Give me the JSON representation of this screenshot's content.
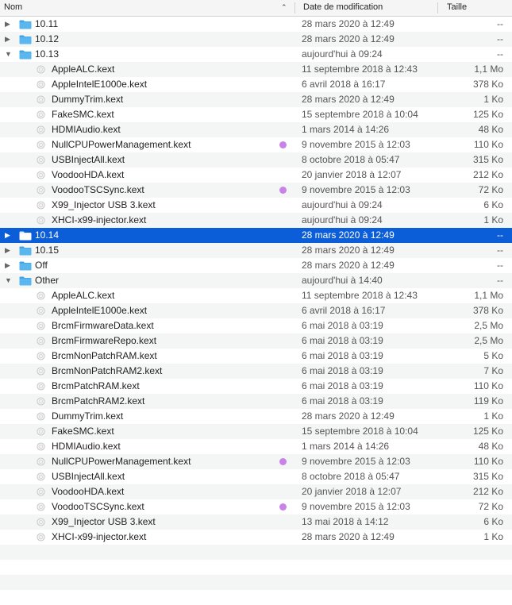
{
  "header": {
    "name_label": "Nom",
    "date_label": "Date de modification",
    "size_label": "Taille"
  },
  "colors": {
    "selection": "#0b5ed7",
    "folder": "#5ab6ee",
    "tag_purple": "#c983e8"
  },
  "rows": [
    {
      "type": "folder",
      "depth": 0,
      "expanded": false,
      "name": "10.11",
      "date": "28 mars 2020 à 12:49",
      "size": "--"
    },
    {
      "type": "folder",
      "depth": 0,
      "expanded": false,
      "name": "10.12",
      "date": "28 mars 2020 à 12:49",
      "size": "--"
    },
    {
      "type": "folder",
      "depth": 0,
      "expanded": true,
      "name": "10.13",
      "date": "aujourd'hui à 09:24",
      "size": "--"
    },
    {
      "type": "file",
      "depth": 1,
      "name": "AppleALC.kext",
      "date": "11 septembre 2018 à 12:43",
      "size": "1,1 Mo"
    },
    {
      "type": "file",
      "depth": 1,
      "name": "AppleIntelE1000e.kext",
      "date": "6 avril 2018 à 16:17",
      "size": "378 Ko"
    },
    {
      "type": "file",
      "depth": 1,
      "name": "DummyTrim.kext",
      "date": "28 mars 2020 à 12:49",
      "size": "1 Ko"
    },
    {
      "type": "file",
      "depth": 1,
      "name": "FakeSMC.kext",
      "date": "15 septembre 2018 à 10:04",
      "size": "125 Ko"
    },
    {
      "type": "file",
      "depth": 1,
      "name": "HDMIAudio.kext",
      "date": "1 mars 2014 à 14:26",
      "size": "48 Ko"
    },
    {
      "type": "file",
      "depth": 1,
      "name": "NullCPUPowerManagement.kext",
      "date": "9 novembre 2015 à 12:03",
      "size": "110 Ko",
      "tag": "purple"
    },
    {
      "type": "file",
      "depth": 1,
      "name": "USBInjectAll.kext",
      "date": "8 octobre 2018 à 05:47",
      "size": "315 Ko"
    },
    {
      "type": "file",
      "depth": 1,
      "name": "VoodooHDA.kext",
      "date": "20 janvier 2018 à 12:07",
      "size": "212 Ko"
    },
    {
      "type": "file",
      "depth": 1,
      "name": "VoodooTSCSync.kext",
      "date": "9 novembre 2015 à 12:03",
      "size": "72 Ko",
      "tag": "purple"
    },
    {
      "type": "file",
      "depth": 1,
      "name": "X99_Injector USB 3.kext",
      "date": "aujourd'hui à 09:24",
      "size": "6 Ko"
    },
    {
      "type": "file",
      "depth": 1,
      "name": "XHCI-x99-injector.kext",
      "date": "aujourd'hui à 09:24",
      "size": "1 Ko"
    },
    {
      "type": "folder",
      "depth": 0,
      "expanded": false,
      "selected": true,
      "name": "10.14",
      "date": "28 mars 2020 à 12:49",
      "size": "--"
    },
    {
      "type": "folder",
      "depth": 0,
      "expanded": false,
      "name": "10.15",
      "date": "28 mars 2020 à 12:49",
      "size": "--"
    },
    {
      "type": "folder",
      "depth": 0,
      "expanded": false,
      "name": "Off",
      "date": "28 mars 2020 à 12:49",
      "size": "--"
    },
    {
      "type": "folder",
      "depth": 0,
      "expanded": true,
      "name": "Other",
      "date": "aujourd'hui à 14:40",
      "size": "--"
    },
    {
      "type": "file",
      "depth": 1,
      "name": "AppleALC.kext",
      "date": "11 septembre 2018 à 12:43",
      "size": "1,1 Mo"
    },
    {
      "type": "file",
      "depth": 1,
      "name": "AppleIntelE1000e.kext",
      "date": "6 avril 2018 à 16:17",
      "size": "378 Ko"
    },
    {
      "type": "file",
      "depth": 1,
      "name": "BrcmFirmwareData.kext",
      "date": "6 mai 2018 à 03:19",
      "size": "2,5 Mo"
    },
    {
      "type": "file",
      "depth": 1,
      "name": "BrcmFirmwareRepo.kext",
      "date": "6 mai 2018 à 03:19",
      "size": "2,5 Mo"
    },
    {
      "type": "file",
      "depth": 1,
      "name": "BrcmNonPatchRAM.kext",
      "date": "6 mai 2018 à 03:19",
      "size": "5 Ko"
    },
    {
      "type": "file",
      "depth": 1,
      "name": "BrcmNonPatchRAM2.kext",
      "date": "6 mai 2018 à 03:19",
      "size": "7 Ko"
    },
    {
      "type": "file",
      "depth": 1,
      "name": "BrcmPatchRAM.kext",
      "date": "6 mai 2018 à 03:19",
      "size": "110 Ko"
    },
    {
      "type": "file",
      "depth": 1,
      "name": "BrcmPatchRAM2.kext",
      "date": "6 mai 2018 à 03:19",
      "size": "119 Ko"
    },
    {
      "type": "file",
      "depth": 1,
      "name": "DummyTrim.kext",
      "date": "28 mars 2020 à 12:49",
      "size": "1 Ko"
    },
    {
      "type": "file",
      "depth": 1,
      "name": "FakeSMC.kext",
      "date": "15 septembre 2018 à 10:04",
      "size": "125 Ko"
    },
    {
      "type": "file",
      "depth": 1,
      "name": "HDMIAudio.kext",
      "date": "1 mars 2014 à 14:26",
      "size": "48 Ko"
    },
    {
      "type": "file",
      "depth": 1,
      "name": "NullCPUPowerManagement.kext",
      "date": "9 novembre 2015 à 12:03",
      "size": "110 Ko",
      "tag": "purple"
    },
    {
      "type": "file",
      "depth": 1,
      "name": "USBInjectAll.kext",
      "date": "8 octobre 2018 à 05:47",
      "size": "315 Ko"
    },
    {
      "type": "file",
      "depth": 1,
      "name": "VoodooHDA.kext",
      "date": "20 janvier 2018 à 12:07",
      "size": "212 Ko"
    },
    {
      "type": "file",
      "depth": 1,
      "name": "VoodooTSCSync.kext",
      "date": "9 novembre 2015 à 12:03",
      "size": "72 Ko",
      "tag": "purple"
    },
    {
      "type": "file",
      "depth": 1,
      "name": "X99_Injector USB 3.kext",
      "date": "13 mai 2018 à 14:12",
      "size": "6 Ko"
    },
    {
      "type": "file",
      "depth": 1,
      "name": "XHCI-x99-injector.kext",
      "date": "28 mars 2020 à 12:49",
      "size": "1 Ko"
    }
  ],
  "empty_rows": 4
}
